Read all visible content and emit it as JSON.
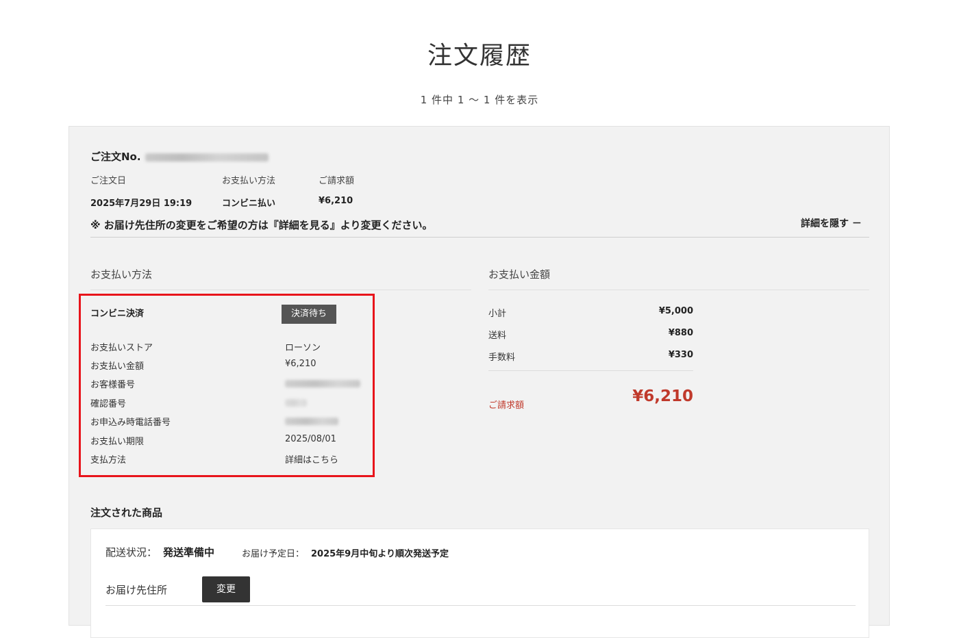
{
  "page": {
    "title": "注文履歴",
    "result_count": "1 件中 1 〜 1 件を表示"
  },
  "order": {
    "number_label": "ご注文No.",
    "date_label": "ご注文日",
    "date_value": "2025年7月29日 19:19",
    "method_label": "お支払い方法",
    "method_value": "コンビニ払い",
    "bill_label": "ご請求額",
    "bill_value": "¥6,210",
    "notice": "※ お届け先住所の変更をご希望の方は『詳細を見る』より変更ください。",
    "toggle_label": "詳細を隠す －"
  },
  "payment": {
    "heading": "お支払い方法",
    "type": "コンビニ決済",
    "status": "決済待ち",
    "rows": [
      {
        "label": "お支払いストア",
        "value": "ローソン"
      },
      {
        "label": "お支払い金額",
        "value": "¥6,210"
      },
      {
        "label": "お客様番号",
        "value": ""
      },
      {
        "label": "確認番号",
        "value": ""
      },
      {
        "label": "お申込み時電話番号",
        "value": ""
      },
      {
        "label": "お支払い期限",
        "value": "2025/08/01"
      },
      {
        "label": "支払方法",
        "value": "詳細はこちら"
      }
    ]
  },
  "amounts": {
    "heading": "お支払い金額",
    "subtotal_label": "小計",
    "subtotal_value": "¥5,000",
    "shipping_label": "送料",
    "shipping_value": "¥880",
    "fee_label": "手数料",
    "fee_value": "¥330",
    "bill_label": "ご請求額",
    "bill_value": "¥6,210"
  },
  "goods": {
    "heading": "注文された商品",
    "delivery_status_label": "配送状況：",
    "delivery_status_value": "発送準備中",
    "delivery_date_label": "お届け予定日：",
    "delivery_date_value": "2025年9月中旬より順次発送予定",
    "address_label": "お届け先住所",
    "change_button": "変更"
  },
  "colors": {
    "accent_red": "#c0392b",
    "highlight_border": "#e8141b",
    "badge_bg": "#555555"
  }
}
